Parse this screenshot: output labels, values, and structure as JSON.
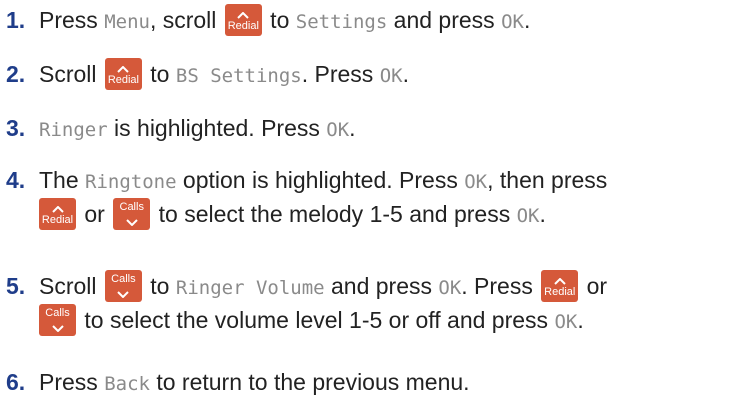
{
  "keys": {
    "redial": "Redial",
    "calls": "Calls"
  },
  "steps": [
    {
      "number": "1",
      "t1": "Press ",
      "lcd1": "Menu",
      "t2": ", scroll ",
      "t3": " to ",
      "lcd2": "Settings",
      "t4": " and press ",
      "lcd3": "OK",
      "t5": "."
    },
    {
      "number": "2",
      "t1": "Scroll ",
      "t2": " to ",
      "lcd1": "BS Settings",
      "t3": ". Press ",
      "lcd2": "OK",
      "t4": "."
    },
    {
      "number": "3",
      "lcd1": "Ringer",
      "t1": " is highlighted. Press ",
      "lcd2": "OK",
      "t2": "."
    },
    {
      "number": "4",
      "t1": "The ",
      "lcd1": "Ringtone",
      "t2": " option is highlighted. Press ",
      "lcd2": "OK",
      "t3": ", then press",
      "t4": " or ",
      "t5": " to select the melody 1-5 and press ",
      "lcd3": "OK",
      "t6": "."
    },
    {
      "number": "5",
      "t1": "Scroll ",
      "t2": " to ",
      "lcd1": "Ringer Volume",
      "t3": " and press ",
      "lcd2": "OK",
      "t4": ". Press ",
      "t5": " or",
      "t6": " to select the volume level 1-5 or off and press ",
      "lcd3": "OK",
      "t7": "."
    },
    {
      "number": "6",
      "t1": "Press ",
      "lcd1": "Back",
      "t2": " to return to the previous menu."
    }
  ]
}
